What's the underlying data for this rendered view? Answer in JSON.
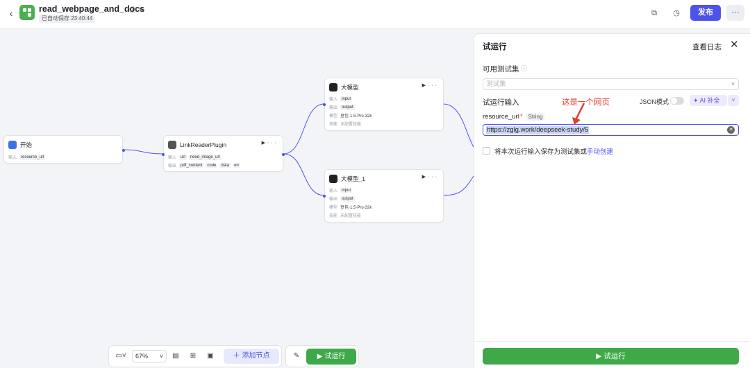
{
  "header": {
    "title": "read_webpage_and_docs",
    "saved_status": "已自动保存 23:40:44",
    "publish_label": "发布",
    "more_label": "···"
  },
  "nodes": {
    "start": {
      "title": "开始",
      "input_label": "输入",
      "input_tag": "resource_url"
    },
    "plugin": {
      "title": "LinkReaderPlugin",
      "input_label": "输入",
      "inputs": [
        "url",
        "need_image_url"
      ],
      "output_label": "输出",
      "outputs": [
        "pdf_content",
        "code",
        "data",
        "err"
      ]
    },
    "llm1": {
      "title": "大模型",
      "input_label": "输入",
      "input_tag": "input",
      "output_label": "输出",
      "output_tag": "output",
      "model_label": "模型",
      "model": "豆包·1.5·Pro·32k",
      "skill_label": "技能",
      "skill": "未配置技能"
    },
    "llm2": {
      "title": "大模型_1",
      "input_label": "输入",
      "input_tag": "input",
      "output_label": "输出",
      "output_tag": "output",
      "model_label": "模型",
      "model": "豆包·1.5·Pro·32k",
      "skill_label": "技能",
      "skill": "未配置技能"
    }
  },
  "toolbar": {
    "zoom": "67%",
    "add_node_label": "添加节点",
    "run_label": "试运行"
  },
  "panel": {
    "title": "试运行",
    "view_log_label": "查看日志",
    "available_sets_label": "可用测试集",
    "test_set_placeholder": "测试集",
    "run_input_label": "试运行输入",
    "json_mode_label": "JSON模式",
    "ai_fill_label": "AI 补全",
    "annotation": "这是一个网页",
    "field_name": "resource_url",
    "field_required": "*",
    "field_type": "String",
    "field_value": "https://zglg.work/deepseek-study/5",
    "save_text": "将本次运行输入保存为测试集或",
    "save_link": "手动创建",
    "run_button_label": "试运行"
  },
  "colors": {
    "accent": "#4d53e8",
    "run_green": "#3fa94a",
    "annotation_red": "#e33b2e",
    "logo_green": "#4caf50"
  }
}
